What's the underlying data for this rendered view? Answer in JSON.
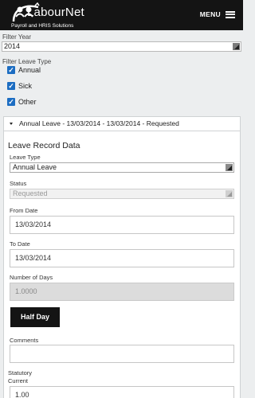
{
  "header": {
    "brand": "LabourNet",
    "tagline": "Payroll and HRIS Solutions",
    "menu_label": "MENU"
  },
  "filters": {
    "year_label": "Filter Year",
    "year_value": "2014",
    "leave_type_label": "Filter Leave Type",
    "leave_types": [
      {
        "label": "Annual",
        "checked": true
      },
      {
        "label": "Sick",
        "checked": true
      },
      {
        "label": "Other",
        "checked": true
      }
    ]
  },
  "record": {
    "summary": "Annual Leave - 13/03/2014 - 13/03/2014 - Requested",
    "title": "Leave Record Data",
    "leave_type_label": "Leave Type",
    "leave_type_value": "Annual Leave",
    "status_label": "Status",
    "status_value": "Requested",
    "from_date_label": "From Date",
    "from_date_value": "13/03/2014",
    "to_date_label": "To Date",
    "to_date_value": "13/03/2014",
    "days_label": "Number of Days",
    "days_value": "1.0000",
    "half_day_label": "Half Day",
    "comments_label": "Comments",
    "comments_value": "",
    "statutory_label": "Statutory",
    "current_label": "Current",
    "current_value": "1.00"
  }
}
